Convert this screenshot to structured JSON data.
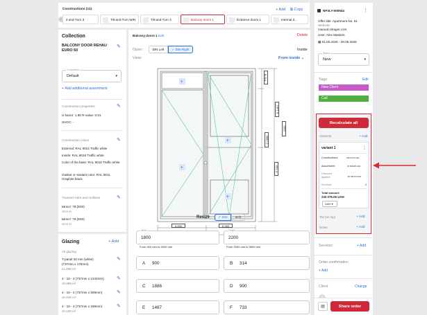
{
  "top_bar": {
    "title": "Constructions (11)",
    "add_label": "+ Add",
    "copy_label": "Copy",
    "tabs": [
      "ıl-and-Turn 3",
      "Tilt-and-Turn WIN",
      "Tilt-and-Turn 4",
      "Balcony doors 1",
      "Entrance doors 1",
      "Internal d..."
    ]
  },
  "collection": {
    "heading": "Collection",
    "name": "BALCONY DOOR REHAU EURO 60",
    "completion_label": "Completion",
    "completion_value": "Default",
    "add_assortment": "+ Add additional assortment",
    "properties_title": "Construction properties",
    "u_factor": "U-factor: 1.95  R-value: 0.51",
    "shgc": "SHGC: -",
    "colors_title": "Construction colors",
    "external": "External: RAL 9016 Traffic white",
    "inside": "Inside: RAL 9016 Traffic white",
    "base_color": "Color of the base: RAL 9016 Traffic white",
    "gasket": "Gasket or sealant color: RAL 9011 Graphite black",
    "transom_title": "Transom bars and mullions",
    "transom_items": [
      {
        "name": "Імпост 78 (Е60)",
        "size": "x0.9 m"
      },
      {
        "name": "Імпост 78 (Е60)",
        "size": "x0.9 m"
      }
    ]
  },
  "glazing": {
    "heading": "Glazing",
    "add_label": "+ Add",
    "all_label": "All glazing",
    "items": [
      {
        "name": "T-panel 32 mm (white)",
        "dims": "(737mm x 176mm)",
        "area": "x1.298 m²"
      },
      {
        "name": "4 - 16 - 4 (737mm x 1342mm)",
        "area": "x0.989 m²"
      },
      {
        "name": "4 - 16 - 4 (737mm x 608mm)",
        "area": "x0.448 m²"
      },
      {
        "name": "4 - 16 - 4 (737mm x 189mm)",
        "area": "x0.139 m²"
      }
    ]
  },
  "editor": {
    "title": "Balcony doors 1",
    "edit_label": "Edit",
    "delete_label": "Delete",
    "open_label": "Open:",
    "din_left": "DIN Left",
    "din_right": "DIN Right",
    "inside_label": "Inside",
    "view_label": "View:",
    "from_inside": "From inside",
    "dim_a": "A 900",
    "dim_d": "D 900",
    "dim_total_width": "1800",
    "dim_b": "B 314",
    "dim_e": "E 1467",
    "dim_c": "C 1886",
    "dim_f": "F 733",
    "dim_total_height": "2200",
    "resize_label": "Resize",
    "unit_mm": "mm",
    "unit_inch": "inch",
    "width_label": "Width",
    "width_value": "1800",
    "width_hint": "From 400 mm to 4000 mm",
    "height_label": "Height",
    "height_value": "2200",
    "height_hint": "From 1500 mm to 3600 mm",
    "fields": [
      {
        "letter": "A",
        "value": "900"
      },
      {
        "letter": "B",
        "value": "314"
      },
      {
        "letter": "C",
        "value": "1886"
      },
      {
        "letter": "D",
        "value": "900"
      },
      {
        "letter": "E",
        "value": "1467"
      },
      {
        "letter": "F",
        "value": "733"
      }
    ]
  },
  "order": {
    "number": "NP3LY-000544",
    "offer_line": "Offer title:  Apartment No. 51",
    "website_label": "Website:",
    "website": "manual.vitrager.com",
    "user": "User:  Alex Masters",
    "dates": "01.05.2026 - 29.05.2026",
    "status_label": "Status",
    "status_value": "New",
    "tags_label": "Tags",
    "tags_edit": "Edit",
    "tag1": "New Client",
    "tag2": "Call",
    "recalculate": "Recalculate all",
    "variants_label": "Variants",
    "variants_add": "+ Add",
    "variant_name": "variant 1",
    "constructions_label": "Constructions",
    "constructions_value": "198 6713 UAH",
    "assortment_label": "Assortment",
    "assortment_value": "33 838.08 UAH",
    "discount_label": "Discount applied",
    "discount_value": "-46 946.63 UAH",
    "services_label": "Services",
    "services_value": "0",
    "total_label": "Total amount:",
    "total_value": "232 076.05 UAH",
    "currency": "UAH",
    "tax_label": "Tax (on top)",
    "tax_add": "+ Add",
    "notes_label": "Notes",
    "notes_add": "+ Add",
    "services_section": "Services",
    "services_add": "+ Add",
    "confirmation_label": "Order confirmation",
    "confirmation_add": "+ Add",
    "client_label": "Client",
    "client_change": "Change",
    "share_order": "Share order"
  },
  "colors": {
    "accent_red": "#d0293a",
    "link_blue": "#2b6fd6",
    "tag_purple": "#c35bc9",
    "tag_green": "#4fae3f",
    "frame_green": "#58c49d"
  }
}
